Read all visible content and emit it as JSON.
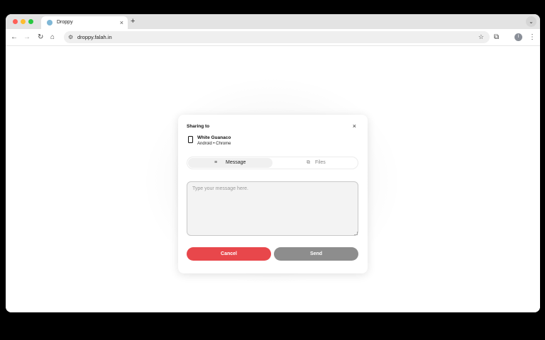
{
  "browser": {
    "tab_title": "Droppy",
    "tab_close": "×",
    "new_tab": "+",
    "tab_menu": "⌄",
    "url": "droppy.falah.in",
    "nav": {
      "back": "←",
      "forward": "→",
      "reload": "↻",
      "home": "⌂"
    },
    "site_info_icon": "⚙",
    "bookmark_icon": "☆",
    "extensions_icon": "⧉",
    "profile_initial": "I",
    "menu_icon": "⋮"
  },
  "dialog": {
    "heading": "Sharing to",
    "close": "×",
    "device": {
      "name": "White Guanaco",
      "info": "Android • Chrome"
    },
    "tabs": [
      {
        "label": "Message",
        "icon": "≡",
        "active": true
      },
      {
        "label": "Files",
        "icon": "⧉",
        "active": false
      }
    ],
    "message": {
      "value": "",
      "placeholder": "Type your message here."
    },
    "cancel_label": "Cancel",
    "send_label": "Send"
  },
  "colors": {
    "cancel": "#e8474b",
    "send_disabled": "#8d8d8d",
    "tab_icon": "#7fb7d6"
  }
}
